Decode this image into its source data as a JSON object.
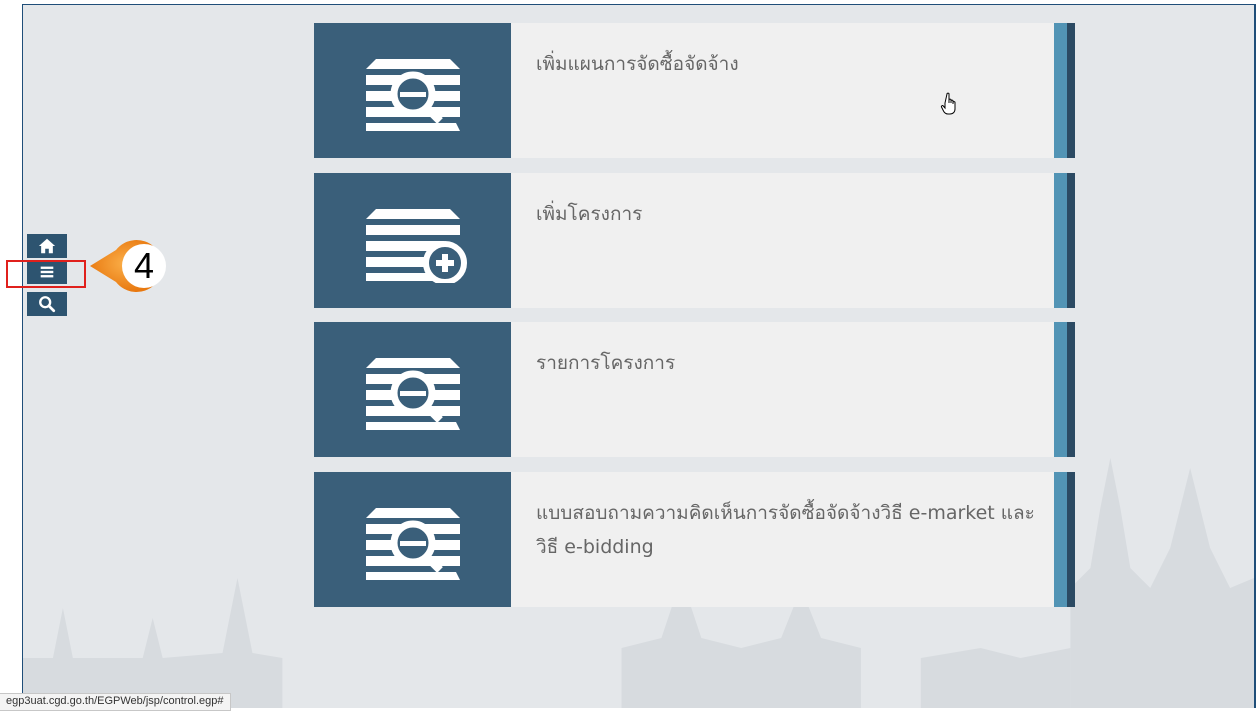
{
  "toolbar": {
    "home_icon": "home-icon",
    "menu_icon": "hamburger-menu-icon",
    "search_icon": "search-icon"
  },
  "callout": {
    "number": "4",
    "color": "#f08a1c"
  },
  "cards": [
    {
      "label": "เพิ่มแผนการจัดซื้อจัดจ้าง",
      "icon": "document-search-icon"
    },
    {
      "label": "เพิ่มโครงการ",
      "icon": "document-add-icon"
    },
    {
      "label": "รายการโครงการ",
      "icon": "document-search-icon"
    },
    {
      "label": "แบบสอบถามความคิดเห็นการจัดซื้อจัดจ้างวิธี e-market และวิธี e-bidding",
      "icon": "document-search-icon"
    }
  ],
  "colors": {
    "card_icon_bg": "#3a5f7a",
    "stripe": "#5294b5",
    "accent_dark": "#2b4a63",
    "highlight_box": "#e0201c"
  },
  "status_bar": {
    "url": "egp3uat.cgd.go.th/EGPWeb/jsp/control.egp#"
  }
}
